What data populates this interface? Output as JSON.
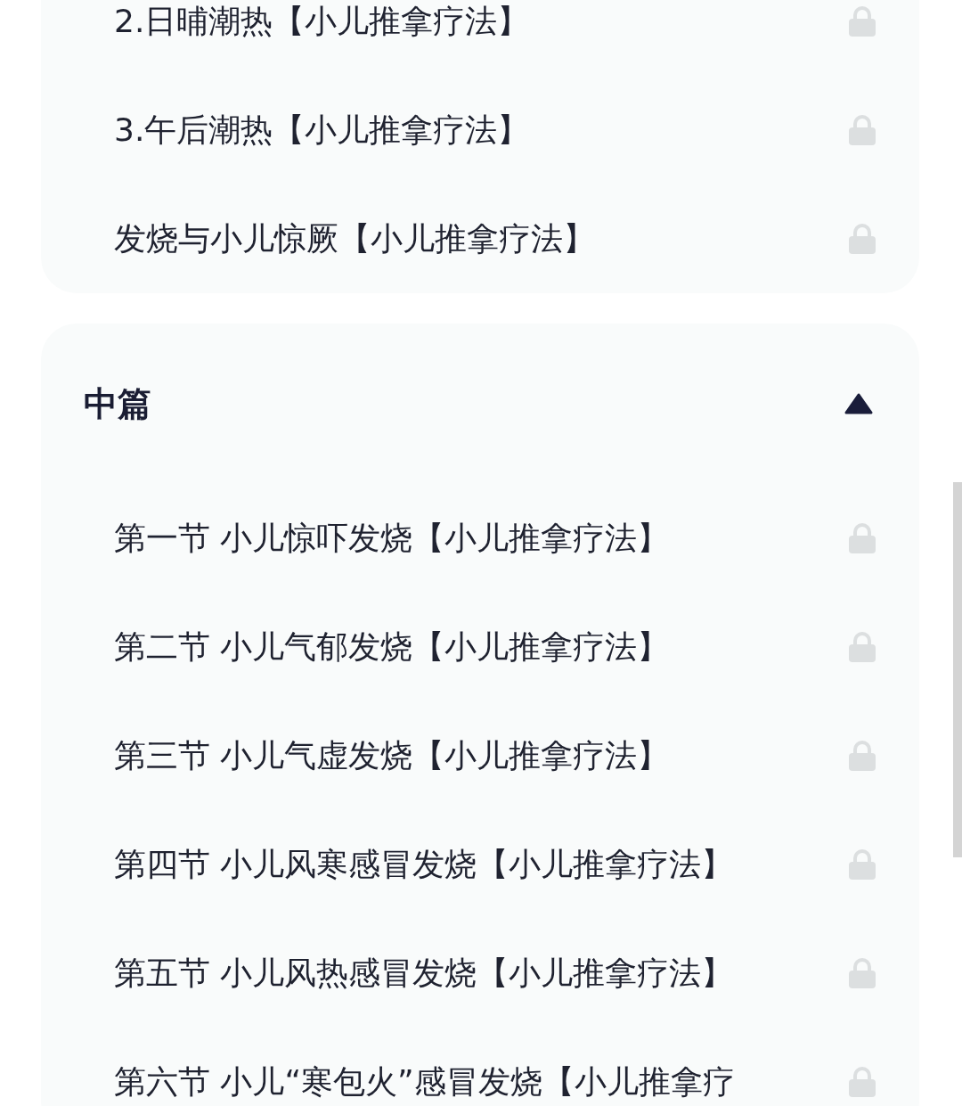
{
  "sections": [
    {
      "items": [
        {
          "label": "2.日晡潮热【小儿推拿疗法】",
          "locked": true
        },
        {
          "label": "3.午后潮热【小儿推拿疗法】",
          "locked": true
        },
        {
          "label": "发烧与小儿惊厥【小儿推拿疗法】",
          "locked": true
        }
      ]
    },
    {
      "title": "中篇",
      "expanded": true,
      "items": [
        {
          "label": "第一节 小儿惊吓发烧【小儿推拿疗法】",
          "locked": true
        },
        {
          "label": "第二节 小儿气郁发烧【小儿推拿疗法】",
          "locked": true
        },
        {
          "label": "第三节 小儿气虚发烧【小儿推拿疗法】",
          "locked": true
        },
        {
          "label": "第四节 小儿风寒感冒发烧【小儿推拿疗法】",
          "locked": true
        },
        {
          "label": "第五节 小儿风热感冒发烧【小儿推拿疗法】",
          "locked": true
        },
        {
          "label": "第六节 小儿“寒包火”感冒发烧【小儿推拿疗",
          "locked": true
        }
      ]
    }
  ]
}
